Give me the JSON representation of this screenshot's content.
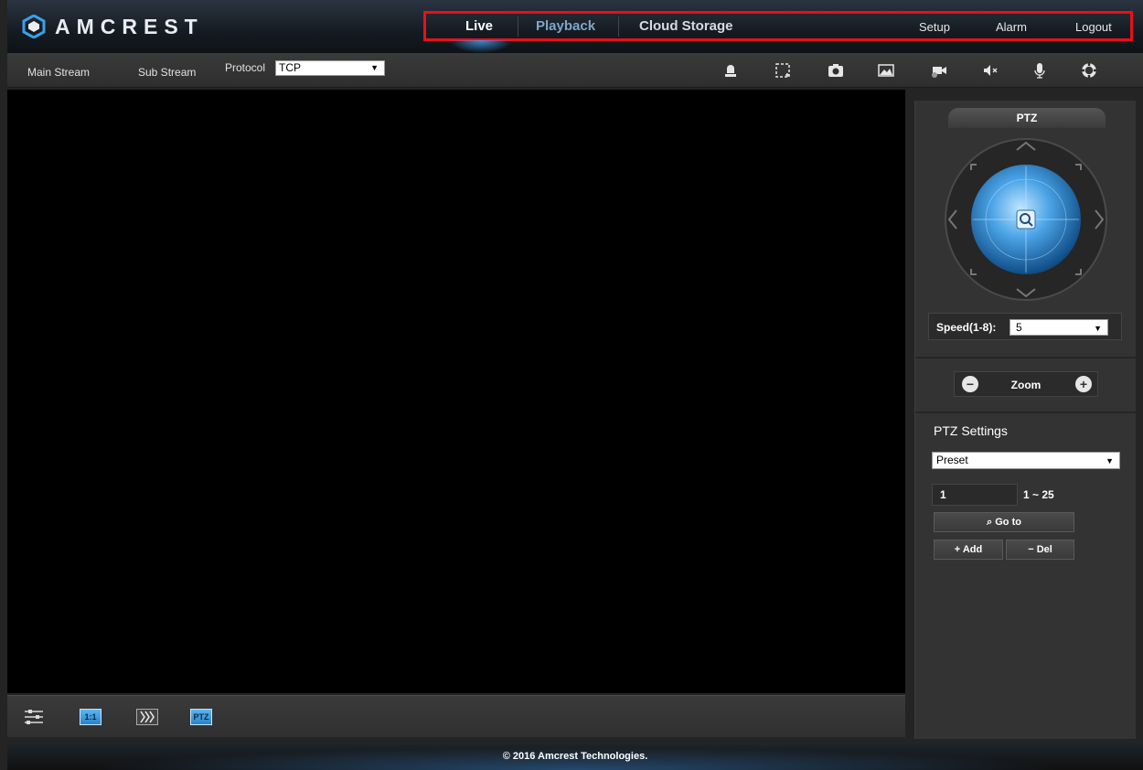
{
  "brand": {
    "name": "AMCREST"
  },
  "nav": {
    "live": "Live",
    "playback": "Playback",
    "cloud_storage": "Cloud Storage",
    "setup": "Setup",
    "alarm": "Alarm",
    "logout": "Logout",
    "active": "Live"
  },
  "toolbar": {
    "main_stream": "Main Stream",
    "sub_stream": "Sub Stream",
    "protocol_label": "Protocol",
    "protocol_value": "TCP",
    "icons": [
      "alarm-icon",
      "zoom-region-icon",
      "snapshot-icon",
      "image-adjust-icon",
      "record-icon",
      "audio-mute-icon",
      "microphone-icon",
      "fullscreen-icon"
    ]
  },
  "bottom_bar": {
    "image_settings_icon": "sliders-icon",
    "ratio_label": "1:1",
    "fluency_icon": "fluency-icon",
    "ptz_label": "PTZ"
  },
  "ptz_panel": {
    "tab_label": "PTZ",
    "speed_label": "Speed(1-8):",
    "speed_value": "5",
    "zoom_label": "Zoom",
    "settings_title": "PTZ Settings",
    "mode_value": "Preset",
    "preset_number": "1",
    "preset_range": "1 ~ 25",
    "goto_label": "Go to",
    "add_label": "Add",
    "del_label": "Del"
  },
  "footer": {
    "copyright": "© 2016 Amcrest Technologies."
  },
  "colors": {
    "highlight_box": "#e8101b",
    "accent_blue": "#3a8ed6"
  }
}
